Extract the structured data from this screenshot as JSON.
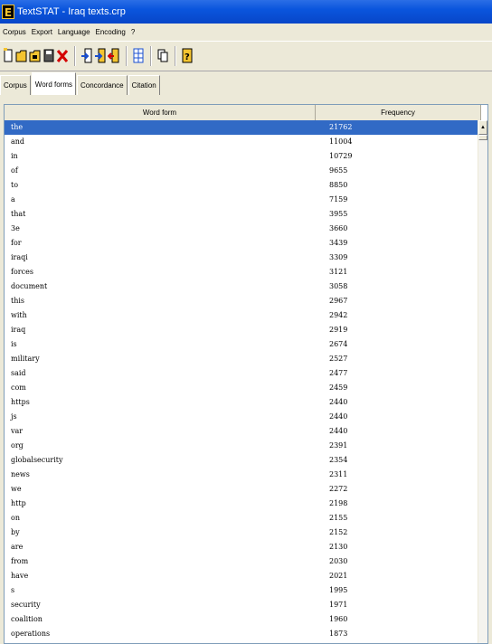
{
  "window": {
    "title": "TextSTAT - Iraq texts.crp",
    "icon": "textstat-app-icon"
  },
  "menu": [
    "Corpus",
    "Export",
    "Language",
    "Encoding",
    "?"
  ],
  "toolbar": {
    "icons": [
      "new-file-icon",
      "open-folder-icon",
      "open-recent-icon",
      "save-icon",
      "delete-icon",
      "add-file-icon",
      "add-web-icon",
      "remove-file-icon",
      "grid-icon",
      "copy-icon",
      "help-icon"
    ]
  },
  "tabs": [
    "Corpus",
    "Word forms",
    "Concordance",
    "Citation"
  ],
  "active_tab": "Word forms",
  "table": {
    "columns": [
      "Word form",
      "Frequency"
    ],
    "selected_index": 0,
    "rows": [
      {
        "word": "the",
        "freq": "21762"
      },
      {
        "word": "and",
        "freq": "11004"
      },
      {
        "word": "in",
        "freq": "10729"
      },
      {
        "word": "of",
        "freq": "9655"
      },
      {
        "word": "to",
        "freq": "8850"
      },
      {
        "word": "a",
        "freq": "7159"
      },
      {
        "word": "that",
        "freq": "3955"
      },
      {
        "word": "3e",
        "freq": "3660"
      },
      {
        "word": "for",
        "freq": "3439"
      },
      {
        "word": "iraqi",
        "freq": "3309"
      },
      {
        "word": "forces",
        "freq": "3121"
      },
      {
        "word": "document",
        "freq": "3058"
      },
      {
        "word": "this",
        "freq": "2967"
      },
      {
        "word": "with",
        "freq": "2942"
      },
      {
        "word": "iraq",
        "freq": "2919"
      },
      {
        "word": "is",
        "freq": "2674"
      },
      {
        "word": "military",
        "freq": "2527"
      },
      {
        "word": "said",
        "freq": "2477"
      },
      {
        "word": "com",
        "freq": "2459"
      },
      {
        "word": "https",
        "freq": "2440"
      },
      {
        "word": "js",
        "freq": "2440"
      },
      {
        "word": "var",
        "freq": "2440"
      },
      {
        "word": "org",
        "freq": "2391"
      },
      {
        "word": "globalsecurity",
        "freq": "2354"
      },
      {
        "word": "news",
        "freq": "2311"
      },
      {
        "word": "we",
        "freq": "2272"
      },
      {
        "word": "http",
        "freq": "2198"
      },
      {
        "word": "on",
        "freq": "2155"
      },
      {
        "word": "by",
        "freq": "2152"
      },
      {
        "word": "are",
        "freq": "2130"
      },
      {
        "word": "from",
        "freq": "2030"
      },
      {
        "word": "have",
        "freq": "2021"
      },
      {
        "word": "s",
        "freq": "1995"
      },
      {
        "word": "security",
        "freq": "1971"
      },
      {
        "word": "coalition",
        "freq": "1960"
      },
      {
        "word": "operations",
        "freq": "1873"
      }
    ]
  },
  "colors": {
    "titlebar": "#0a55dd",
    "selection": "#316ac5",
    "face": "#ece9d8"
  }
}
